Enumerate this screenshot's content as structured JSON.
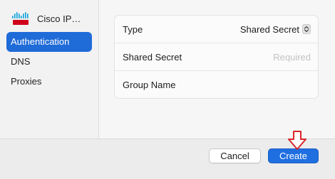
{
  "sidebar": {
    "header": {
      "label": "Cisco IP…",
      "icon": "cisco-logo-icon"
    },
    "items": [
      {
        "label": "Authentication",
        "selected": true
      },
      {
        "label": "DNS",
        "selected": false
      },
      {
        "label": "Proxies",
        "selected": false
      }
    ]
  },
  "form": {
    "type_label": "Type",
    "type_value": "Shared Secret",
    "shared_secret_label": "Shared Secret",
    "shared_secret_placeholder": "Required",
    "group_name_label": "Group Name",
    "group_name_value": ""
  },
  "footer": {
    "cancel_label": "Cancel",
    "create_label": "Create"
  },
  "colors": {
    "accent": "#1f6fe0",
    "sidebar_selected": "#1f6bd8",
    "arrow": "#d9262b"
  }
}
